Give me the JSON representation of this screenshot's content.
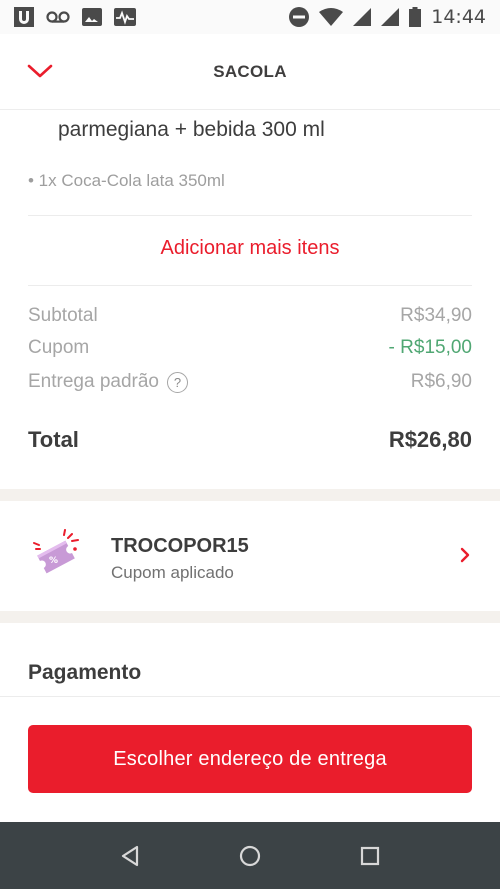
{
  "status_bar": {
    "time": "14:44",
    "icons": [
      "u-app-icon",
      "voicemail-icon",
      "image-icon",
      "pulse-icon",
      "do-not-disturb-icon",
      "wifi-icon",
      "signal-icon",
      "signal-icon-2",
      "battery-icon"
    ]
  },
  "header": {
    "title": "SACOLA",
    "back_icon": "chevron-down-icon",
    "accent": "#ea1d2c"
  },
  "order": {
    "item_name": "parmegiana + bebida 300 ml",
    "item_extra": "• 1x Coca-Cola lata 350ml",
    "add_more_label": "Adicionar mais itens"
  },
  "summary": {
    "subtotal_label": "Subtotal",
    "subtotal_value": "R$34,90",
    "coupon_label": "Cupom",
    "coupon_value": "- R$15,00",
    "delivery_label": "Entrega padrão",
    "delivery_help": "?",
    "delivery_value": "R$6,90",
    "total_label": "Total",
    "total_value": "R$26,80",
    "discount_color": "#50a773"
  },
  "coupon": {
    "code": "TROCOPOR15",
    "status": "Cupom aplicado",
    "icon": "coupon-ticket-icon",
    "icon_text": "%"
  },
  "payment": {
    "title": "Pagamento"
  },
  "footer": {
    "cta_label": "Escolher endereço de entrega"
  },
  "nav": {
    "back_icon": "nav-back-icon",
    "home_icon": "nav-home-icon",
    "recents_icon": "nav-recents-icon"
  }
}
